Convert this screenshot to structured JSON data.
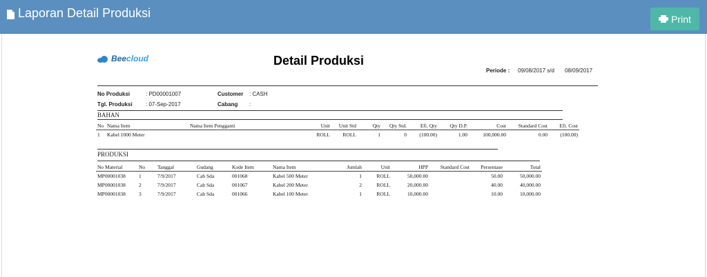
{
  "header": {
    "title": "Laporan Detail Produksi",
    "print_label": "Print"
  },
  "report": {
    "logo_text_a": "Bee",
    "logo_text_b": "cloud",
    "title": "Detail Produksi",
    "periode_label": "Periode :",
    "periode_from": "09/08/2017 s/d",
    "periode_to": "08/09/2017",
    "info": {
      "no_produksi_label": "No Produksi",
      "no_produksi_value": ": PD00001007",
      "tgl_produksi_label": "Tgl. Produksi",
      "tgl_produksi_value": ": 07-Sep-2017",
      "customer_label": "Customer",
      "customer_value": ": CASH",
      "cabang_label": "Cabang",
      "cabang_value": ":"
    },
    "bahan": {
      "section_title": "BAHAN",
      "headers": [
        "No",
        "Nama Item",
        "Nama Item Pengganti",
        "Unit",
        "Unit Std",
        "Qty",
        "Qty Std.",
        "Efi. Qty",
        "Qty D.P.",
        "Cost",
        "Standard Cost",
        "Efi. Cost"
      ],
      "rows": [
        [
          "1",
          "Kabel 1000 Meter",
          "",
          "ROLL",
          "ROLL",
          "1",
          "0",
          "(100.00)",
          "1.00",
          "100,000.00",
          "0.00",
          "(100.00)"
        ]
      ]
    },
    "produksi": {
      "section_title": "PRODUKSI",
      "headers": [
        "No Material",
        "No",
        "Tanggal",
        "Gudang",
        "Kode Item",
        "Nama Item",
        "Jumlah",
        "Unit",
        "HPP",
        "Standard Cost",
        "Persentase",
        "Total"
      ],
      "rows": [
        [
          "MP00001038",
          "1",
          "7/9/2017",
          "Cab Sda",
          "001068",
          "Kabel 500 Meter",
          "1",
          "ROLL",
          "50,000.00",
          "",
          "50.00",
          "50,000.00"
        ],
        [
          "MP00001038",
          "2",
          "7/9/2017",
          "Cab Sda",
          "001067",
          "Kabel 200 Meter",
          "2",
          "ROLL",
          "20,000.00",
          "",
          "40.00",
          "40,000.00"
        ],
        [
          "MP00001038",
          "3",
          "7/9/2017",
          "Cab Sda",
          "001066",
          "Kabel 100 Meter",
          "1",
          "ROLL",
          "10,000.00",
          "",
          "10.00",
          "10,000.00"
        ]
      ]
    }
  }
}
